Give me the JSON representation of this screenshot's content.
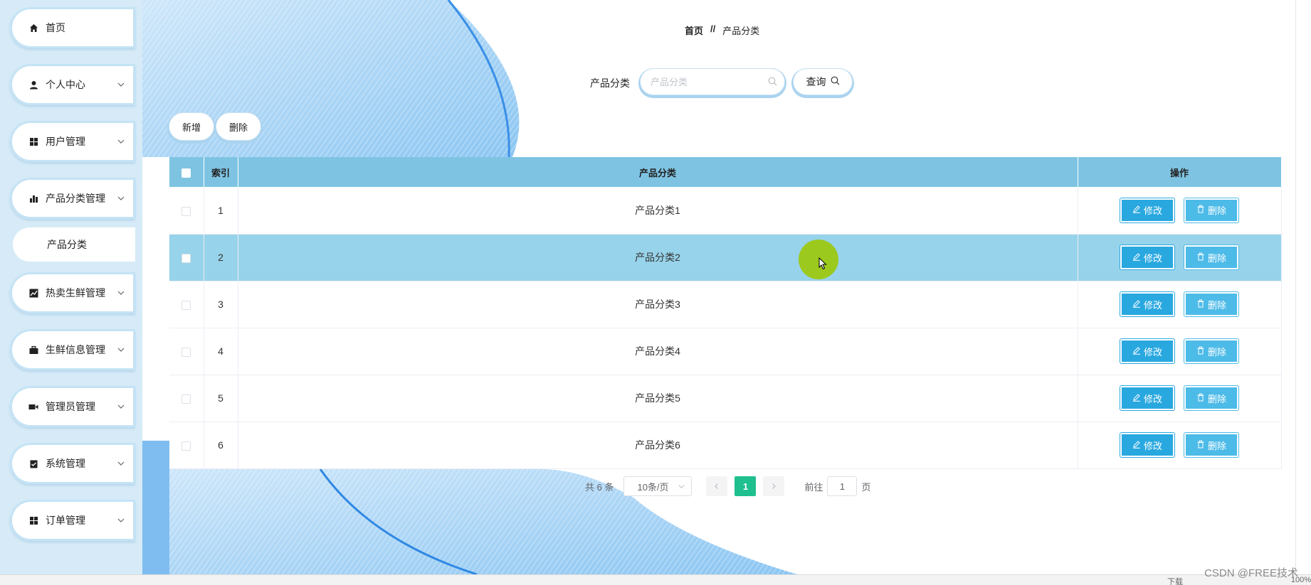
{
  "sidebar": {
    "items": [
      {
        "label": "首页",
        "icon": "home-icon"
      },
      {
        "label": "个人中心",
        "icon": "user-icon"
      },
      {
        "label": "用户管理",
        "icon": "grid-icon"
      },
      {
        "label": "产品分类管理",
        "icon": "bar-chart-icon"
      },
      {
        "label": "热卖生鲜管理",
        "icon": "line-chart-icon"
      },
      {
        "label": "生鲜信息管理",
        "icon": "briefcase-icon"
      },
      {
        "label": "管理员管理",
        "icon": "video-icon"
      },
      {
        "label": "系统管理",
        "icon": "clipboard-icon"
      },
      {
        "label": "订单管理",
        "icon": "grid-icon"
      }
    ],
    "sub_item": "产品分类"
  },
  "breadcrumb": {
    "home": "首页",
    "separator": "//",
    "current": "产品分类"
  },
  "search": {
    "label": "产品分类",
    "placeholder": "产品分类",
    "button": "查询"
  },
  "actions": {
    "add": "新增",
    "delete": "删除"
  },
  "table": {
    "headers": {
      "index": "索引",
      "category": "产品分类",
      "ops": "操作"
    },
    "rows": [
      {
        "index": "1",
        "category": "产品分类1"
      },
      {
        "index": "2",
        "category": "产品分类2"
      },
      {
        "index": "3",
        "category": "产品分类3"
      },
      {
        "index": "4",
        "category": "产品分类4"
      },
      {
        "index": "5",
        "category": "产品分类5"
      },
      {
        "index": "6",
        "category": "产品分类6"
      }
    ],
    "edit_label": "修改",
    "delete_label": "删除",
    "highlighted_row": 2
  },
  "pagination": {
    "total": "共 6 条",
    "page_size": "10条/页",
    "current_page": "1",
    "goto_label": "前往",
    "goto_value": "1",
    "page_unit": "页"
  },
  "statusbar": {
    "watermark": "CSDN @FREE技术",
    "zoom": "100%",
    "download": "下载"
  },
  "colors": {
    "header_bg": "#7ec4e2",
    "highlight_row": "#97d3ea",
    "op_button": "#29a8e0",
    "active_page": "#1fbf8f",
    "sidebar_bg": "#d6ebf7"
  }
}
